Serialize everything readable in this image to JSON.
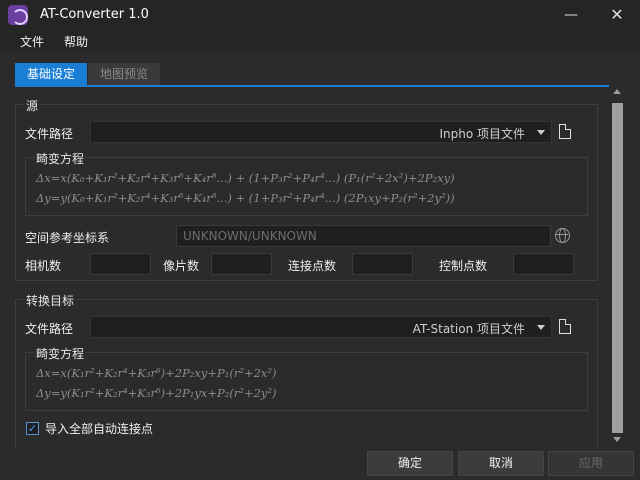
{
  "app": {
    "title": "AT-Converter 1.0"
  },
  "menu": {
    "file": "文件",
    "help": "帮助"
  },
  "tabs": [
    {
      "label": "基础设定",
      "active": true
    },
    {
      "label": "地图预览",
      "active": false
    }
  ],
  "source": {
    "group_title": "源",
    "file_path_label": "文件路径",
    "format_selected": "Inpho 项目文件",
    "distortion": {
      "title": "畸变方程",
      "eq1": "Δx=x(K₀+K₁r²+K₂r⁴+K₃r⁶+K₄r⁸...) + (1+P₃r²+P₄r⁴...) (P₁(r²+2x²)+2P₂xy)",
      "eq2": "Δy=y(K₀+K₁r²+K₂r⁴+K₃r⁶+K₄r⁸...) + (1+P₃r²+P₄r⁴...) (2P₁xy+P₂(r²+2y²))"
    },
    "crs_label": "空间参考坐标系",
    "crs_value": "UNKNOWN/UNKNOWN",
    "camera_count_label": "相机数",
    "camera_count": "",
    "photo_count_label": "像片数",
    "photo_count": "",
    "tie_count_label": "连接点数",
    "tie_count": "",
    "control_count_label": "控制点数",
    "control_count": ""
  },
  "target": {
    "group_title": "转换目标",
    "file_path_label": "文件路径",
    "format_selected": "AT-Station 项目文件",
    "distortion": {
      "title": "畸变方程",
      "eq1": "Δx=x(K₁r²+K₂r⁴+K₃r⁶)+2P₂xy+P₁(r²+2x²)",
      "eq2": "Δy=y(K₁r²+K₂r⁴+K₃r⁶)+2P₁yx+P₂(r²+2y²)"
    },
    "import_all_auto_tie_label": "导入全部自动连接点",
    "import_all_auto_tie_checked": true
  },
  "buttons": {
    "ok": "确定",
    "cancel": "取消",
    "apply": "应用"
  },
  "colors": {
    "accent": "#1a7fd4",
    "background": "#2b2b2b",
    "field": "#1f1f1f"
  },
  "icons": {
    "app": "app-logo",
    "file": "file-icon",
    "globe": "globe-icon"
  }
}
